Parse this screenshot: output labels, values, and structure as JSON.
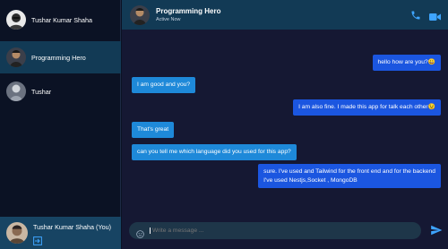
{
  "sidebar": {
    "contacts": [
      {
        "name": "Tushar Kumar Shaha",
        "icon": "avatar-icon"
      },
      {
        "name": "Programming Hero",
        "icon": "avatar-icon"
      },
      {
        "name": "Tushar",
        "icon": "avatar-icon"
      }
    ],
    "current_user": {
      "name": "Tushar Kumar Shaha (You)",
      "logout_icon": "logout-icon"
    }
  },
  "chat": {
    "header": {
      "name": "Programming Hero",
      "status": "Active Now",
      "call_icon": "phone-icon",
      "video_icon": "video-icon"
    },
    "messages": [
      {
        "from": "me",
        "text": "hello how are you?😀"
      },
      {
        "from": "them",
        "text": "I am good and you?"
      },
      {
        "from": "me",
        "text": "I am also fine. I made this app for talk each other😉"
      },
      {
        "from": "them",
        "text": "That's great"
      },
      {
        "from": "them",
        "text": "can you tell me which language did you used for this app?"
      },
      {
        "from": "me",
        "line1": "sure. I've used and Tailwind for the front end and for the backend",
        "line2": "I've used Nestjs,Socket , MongoDB"
      }
    ],
    "composer": {
      "placeholder": "Write a message ...",
      "emoji_icon": "emoji-icon",
      "send_icon": "send-icon"
    }
  },
  "colors": {
    "accent": "#1e89d9",
    "outgoing": "#1b56e0",
    "sidebar_active": "#123a55",
    "background": "#151833"
  }
}
